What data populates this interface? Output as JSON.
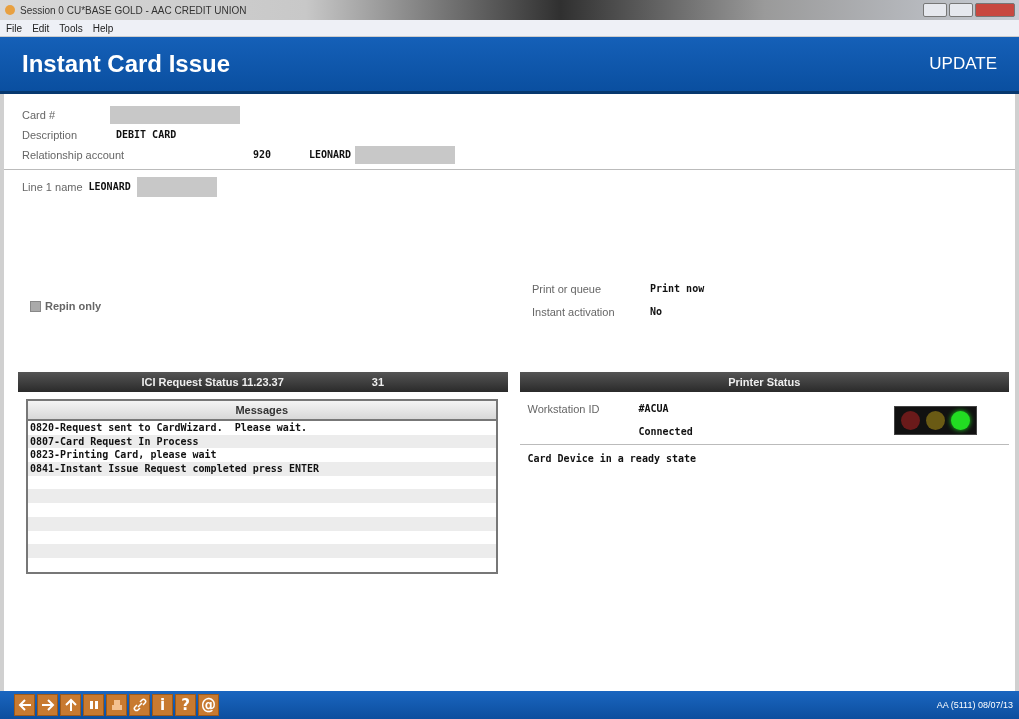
{
  "window": {
    "title": "Session 0 CU*BASE GOLD - AAC CREDIT UNION"
  },
  "menu": [
    "File",
    "Edit",
    "Tools",
    "Help"
  ],
  "header": {
    "title": "Instant Card Issue",
    "mode": "UPDATE"
  },
  "card": {
    "card_label": "Card #",
    "description_label": "Description",
    "description": "DEBIT CARD",
    "relationship_label": "Relationship account",
    "relationship_number": "920",
    "relationship_name": "LEONARD"
  },
  "line1": {
    "label": "Line 1 name",
    "value": "LEONARD"
  },
  "repin": {
    "label": "Repin only",
    "checked": false
  },
  "print_or_queue": {
    "label": "Print or queue",
    "value": "Print now"
  },
  "instant_activation": {
    "label": "Instant activation",
    "value": "No"
  },
  "ici_status": {
    "title": "ICI Request Status 11.23.37",
    "count": "31"
  },
  "messages": {
    "heading": "Messages",
    "lines": [
      "0820-Request sent to CardWizard.  Please wait.",
      "0807-Card Request In Process",
      "0823-Printing Card, please wait",
      "0841-Instant Issue Request completed press ENTER"
    ]
  },
  "printer_status": {
    "title": "Printer Status",
    "workstation_label": "Workstation ID",
    "workstation_id": "#ACUA",
    "connection": "Connected",
    "device_message": "Card Device in a ready state",
    "lights": [
      {
        "color": "#6a1a1a",
        "on": false
      },
      {
        "color": "#6a5a14",
        "on": false
      },
      {
        "color": "#22dd22",
        "on": true
      }
    ]
  },
  "toolbar": [
    {
      "kind": "back"
    },
    {
      "kind": "forward"
    },
    {
      "kind": "up"
    },
    {
      "kind": "pause"
    },
    {
      "kind": "print"
    },
    {
      "kind": "link"
    },
    {
      "kind": "glyph",
      "label": "i"
    },
    {
      "kind": "glyph",
      "label": "?"
    },
    {
      "kind": "glyph",
      "label": "@"
    }
  ],
  "status_bar": "AA (5111) 08/07/13"
}
